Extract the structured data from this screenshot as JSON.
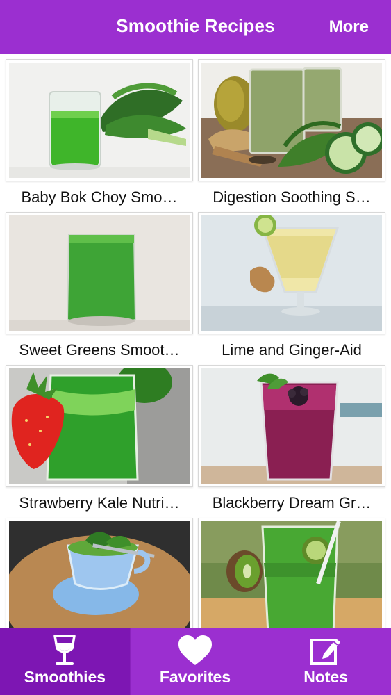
{
  "navbar": {
    "title": "Smoothie Recipes",
    "more_label": "More",
    "color": "#9b2fd0"
  },
  "recipes": [
    {
      "caption": "Baby Bok Choy Smo…"
    },
    {
      "caption": "Digestion Soothing S…"
    },
    {
      "caption": "Sweet Greens Smoot…"
    },
    {
      "caption": "Lime and Ginger-Aid"
    },
    {
      "caption": "Strawberry Kale Nutri…"
    },
    {
      "caption": "Blackberry Dream Gr…"
    },
    {
      "caption": ""
    },
    {
      "caption": ""
    }
  ],
  "tabbar": {
    "tabs": [
      {
        "label": "Smoothies",
        "icon": "wine-glass-icon",
        "selected": true
      },
      {
        "label": "Favorites",
        "icon": "heart-icon",
        "selected": false
      },
      {
        "label": "Notes",
        "icon": "notepad-pencil-icon",
        "selected": false
      }
    ]
  }
}
